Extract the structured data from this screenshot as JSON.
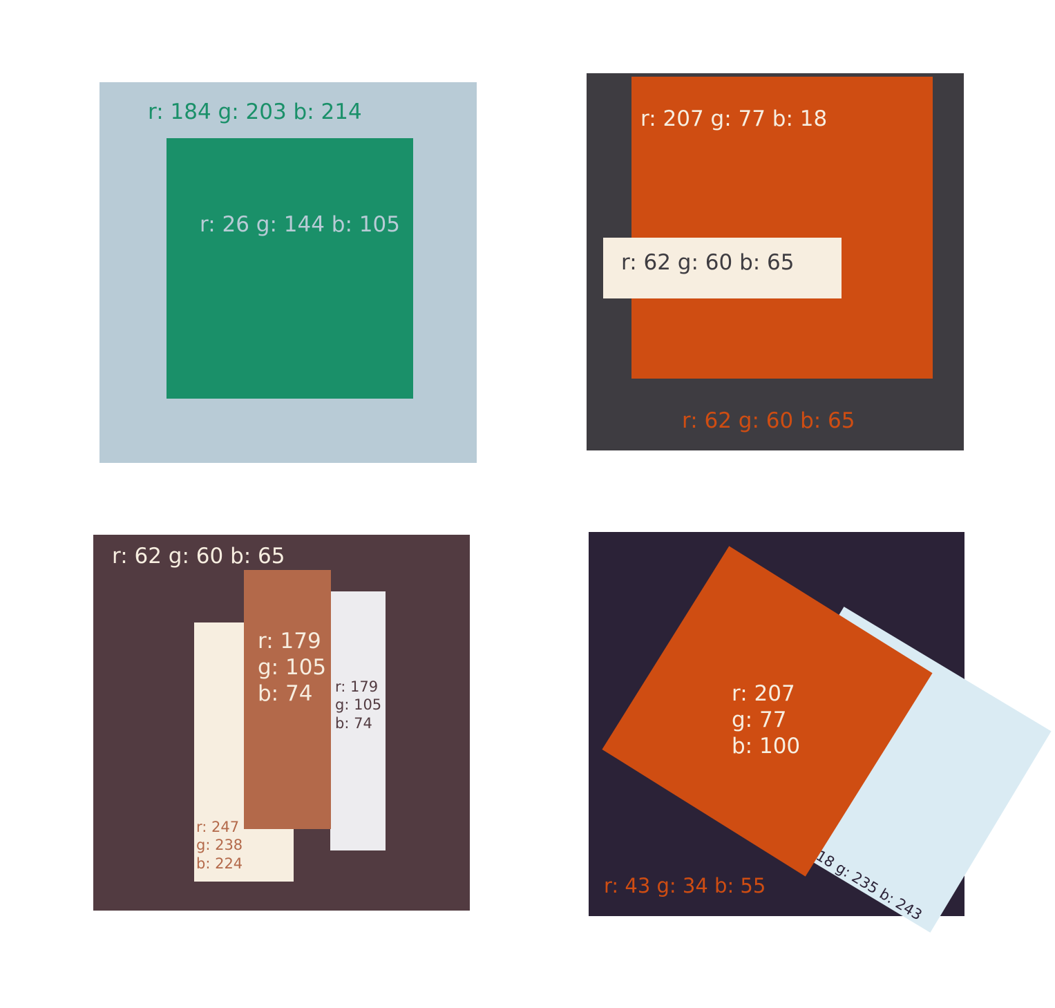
{
  "panels": [
    {
      "id": "top-left",
      "background": "#B8CBD6",
      "background_label": "r: 184 g: 203 b: 214",
      "background_label_color": "#1A9069",
      "shapes": [
        {
          "name": "inner-square",
          "color": "#1A9069",
          "label": "r: 26 g: 144 b: 105",
          "label_color": "#B8CBD6"
        }
      ]
    },
    {
      "id": "top-right",
      "background": "#3E3C41",
      "background_label": "r: 62 g: 60 b: 65",
      "background_label_color": "#CF4D12",
      "shapes": [
        {
          "name": "orange-square",
          "color": "#CF4D12",
          "label": "r: 207 g: 77 b: 18",
          "label_color": "#F7EEE0"
        },
        {
          "name": "cream-bar",
          "color": "#F7EEE0",
          "label": "r: 62 g: 60 b: 65",
          "label_color": "#3E3C41"
        }
      ]
    },
    {
      "id": "bottom-left",
      "background": "#523B41",
      "background_label": "r: 62 g: 60 b: 65",
      "background_label_color": "#F7EEE0",
      "shapes": [
        {
          "name": "cream-strip",
          "color": "#F7EEE0",
          "label": "r: 247\ng: 238\nb: 224",
          "label_color": "#B3694A"
        },
        {
          "name": "brown-strip",
          "color": "#B3694A",
          "label": "r: 179\ng: 105\nb: 74",
          "label_color": "#F7EEE0"
        },
        {
          "name": "gray-strip",
          "color": "#EDECEF",
          "label": "r: 179\ng: 105\nb: 74",
          "label_color": "#523B41"
        }
      ]
    },
    {
      "id": "bottom-right",
      "background": "#2B2237",
      "background_label": "r: 43 g: 34 b: 55",
      "background_label_color": "#CF4D12",
      "shapes": [
        {
          "name": "light-blue-tilted",
          "color": "#DAEBF3",
          "label": "r: 218 g: 235 b: 243",
          "label_color": "#2B2237"
        },
        {
          "name": "orange-tilted",
          "color": "#CF4D12",
          "label": "r: 207\ng: 77\nb: 100",
          "label_color": "#F7EEE0"
        }
      ]
    }
  ]
}
